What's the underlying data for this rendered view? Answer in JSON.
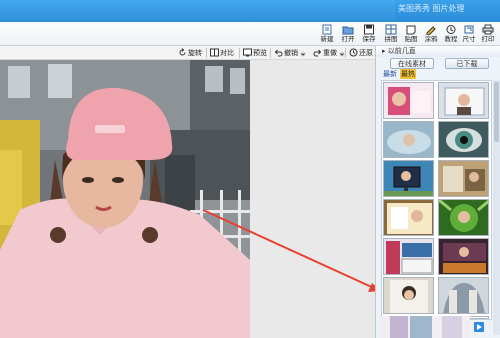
{
  "window": {
    "title": "美图秀秀 图片处理"
  },
  "toolbar": {
    "items": [
      {
        "label": "新建",
        "icon": "new-file-icon"
      },
      {
        "label": "打开",
        "icon": "open-folder-icon"
      },
      {
        "label": "保存",
        "icon": "save-icon"
      },
      {
        "label": "拼图",
        "icon": "collage-icon"
      },
      {
        "label": "贴图",
        "icon": "sticker-icon"
      },
      {
        "label": "涂鸦",
        "icon": "doodle-icon"
      },
      {
        "label": "教程",
        "icon": "tutorial-icon"
      },
      {
        "label": "尺寸",
        "icon": "resize-icon"
      },
      {
        "label": "打印",
        "icon": "print-icon"
      }
    ]
  },
  "edit_bar": {
    "rotate": "旋转",
    "compare": "对比",
    "preview": "预览",
    "undo": "撤销",
    "redo": "重做",
    "restore": "还原"
  },
  "sidebar": {
    "header": "以前几直",
    "tabs": [
      "在线素材",
      "已下载"
    ],
    "subtabs": [
      "最新",
      "最热"
    ],
    "active_subtab": "最热"
  },
  "colors": {
    "accent": "#2b8cd8",
    "arrow": "#e8412f",
    "subtab_active": "#f6c136"
  }
}
